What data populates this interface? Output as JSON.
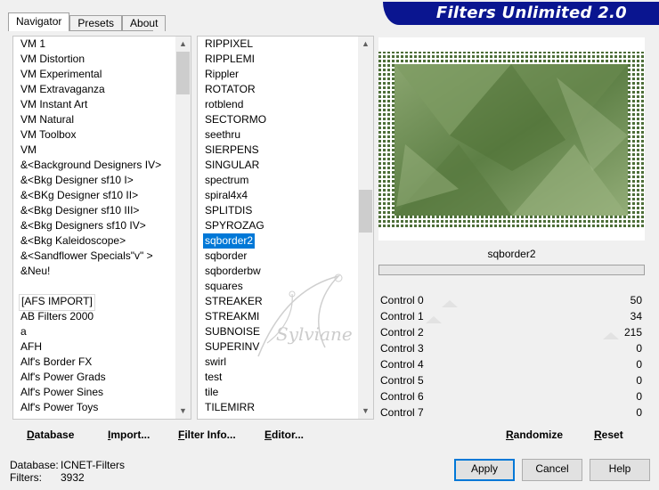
{
  "tabs": [
    {
      "label": "Navigator",
      "active": true
    },
    {
      "label": "Presets",
      "active": false
    },
    {
      "label": "About",
      "active": false
    }
  ],
  "title": "Filters Unlimited 2.0",
  "categories": [
    {
      "label": "VM 1"
    },
    {
      "label": "VM Distortion"
    },
    {
      "label": "VM Experimental"
    },
    {
      "label": "VM Extravaganza"
    },
    {
      "label": "VM Instant Art"
    },
    {
      "label": "VM Natural"
    },
    {
      "label": "VM Toolbox"
    },
    {
      "label": "VM"
    },
    {
      "label": "&<Background Designers IV>"
    },
    {
      "label": "&<Bkg Designer sf10 I>"
    },
    {
      "label": "&<BKg Designer sf10 II>"
    },
    {
      "label": "&<Bkg Designer sf10 III>"
    },
    {
      "label": "&<Bkg Designers sf10 IV>"
    },
    {
      "label": "&<Bkg Kaleidoscope>"
    },
    {
      "label": "&<Sandflower Specials\"v\" >"
    },
    {
      "label": "&Neu!"
    },
    {
      "label": ""
    },
    {
      "label": "[AFS IMPORT]"
    },
    {
      "label": "AB Filters 2000"
    },
    {
      "label": "a"
    },
    {
      "label": "AFH"
    },
    {
      "label": "Alf's Border FX"
    },
    {
      "label": "Alf's Power Grads"
    },
    {
      "label": "Alf's Power Sines"
    },
    {
      "label": "Alf's Power Toys"
    }
  ],
  "filters": [
    {
      "label": "RIPPIXEL"
    },
    {
      "label": "RIPPLEMI"
    },
    {
      "label": "Rippler"
    },
    {
      "label": "ROTATOR"
    },
    {
      "label": "rotblend"
    },
    {
      "label": "SECTORMO"
    },
    {
      "label": "seethru"
    },
    {
      "label": "SIERPENS"
    },
    {
      "label": "SINGULAR"
    },
    {
      "label": "spectrum"
    },
    {
      "label": "spiral4x4"
    },
    {
      "label": "SPLITDIS"
    },
    {
      "label": "SPYROZAG"
    },
    {
      "label": "sqborder2"
    },
    {
      "label": "sqborder"
    },
    {
      "label": "sqborderbw"
    },
    {
      "label": "squares"
    },
    {
      "label": "STREAKER"
    },
    {
      "label": "STREAKMI"
    },
    {
      "label": "SUBNOISE"
    },
    {
      "label": "SUPERINV"
    },
    {
      "label": "swirl"
    },
    {
      "label": "test"
    },
    {
      "label": "tile"
    },
    {
      "label": "TILEMIRR"
    }
  ],
  "selected_filter": "sqborder2",
  "controls": [
    {
      "label": "Control 0",
      "value": "50",
      "level": 0.196
    },
    {
      "label": "Control 1",
      "value": "34",
      "level": 0.133
    },
    {
      "label": "Control 2",
      "value": "215",
      "level": 0.843
    },
    {
      "label": "Control 3",
      "value": "0",
      "level": 0
    },
    {
      "label": "Control 4",
      "value": "0",
      "level": 0
    },
    {
      "label": "Control 5",
      "value": "0",
      "level": 0
    },
    {
      "label": "Control 6",
      "value": "0",
      "level": 0
    },
    {
      "label": "Control 7",
      "value": "0",
      "level": 0
    }
  ],
  "buttons": {
    "database": "Database",
    "import": "Import...",
    "filter_info": "Filter Info...",
    "editor": "Editor...",
    "randomize": "Randomize",
    "reset": "Reset",
    "apply": "Apply",
    "cancel": "Cancel",
    "help": "Help"
  },
  "status": {
    "database_label": "Database:",
    "database_value": "ICNET-Filters",
    "filters_label": "Filters:",
    "filters_value": "3932"
  },
  "watermark": "Sylviane",
  "colors": {
    "banner": "#0a1590",
    "selection": "#0078d7",
    "preview_green": "#6f8f55"
  }
}
